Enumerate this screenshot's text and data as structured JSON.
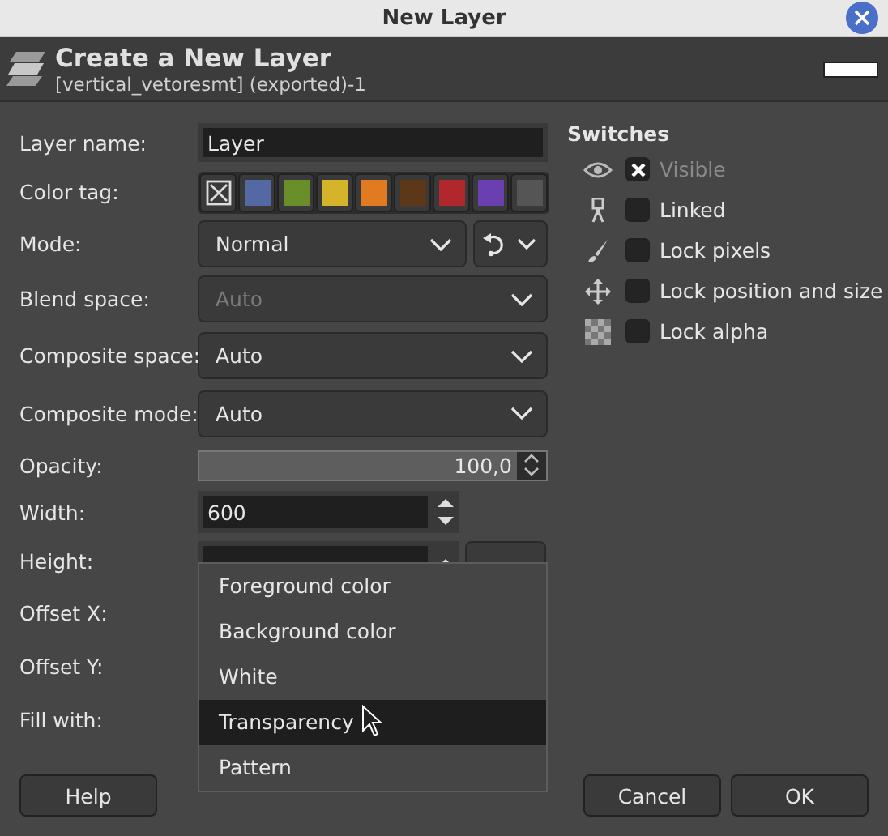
{
  "window": {
    "title": "New Layer"
  },
  "header": {
    "title": "Create a New Layer",
    "subtitle": "[vertical_vetoresmt] (exported)-1"
  },
  "form": [
    {
      "label": "Layer name:",
      "kind": "text",
      "value": "Layer"
    },
    {
      "label": "Color tag:",
      "kind": "colortag",
      "tags": [
        {
          "kind": "none"
        },
        {
          "kind": "color",
          "color": "#5468a4"
        },
        {
          "kind": "color",
          "color": "#6a8f2a"
        },
        {
          "kind": "color",
          "color": "#d4b52a"
        },
        {
          "kind": "color",
          "color": "#e07b22"
        },
        {
          "kind": "color",
          "color": "#5c3718"
        },
        {
          "kind": "color",
          "color": "#b0272c"
        },
        {
          "kind": "color",
          "color": "#6a3fb0"
        },
        {
          "kind": "color",
          "color": "#555555"
        }
      ]
    },
    {
      "label": "Mode:",
      "kind": "mode",
      "value": "Normal",
      "disabled": false
    },
    {
      "label": "Blend space:",
      "kind": "combo",
      "value": "Auto",
      "disabled": true
    },
    {
      "label": "Composite space:",
      "kind": "combo",
      "value": "Auto",
      "disabled": false
    },
    {
      "label": "Composite mode:",
      "kind": "combo",
      "value": "Auto",
      "disabled": false
    },
    {
      "label": "Opacity:",
      "kind": "scale",
      "value": "100,0",
      "level": 1
    },
    {
      "label": "Width:",
      "kind": "spin",
      "value": "600"
    },
    {
      "label": "Height:",
      "kind": "spin_unit"
    },
    {
      "label": "Offset X:",
      "kind": "label"
    },
    {
      "label": "Offset Y:",
      "kind": "label"
    },
    {
      "label": "Fill with:",
      "kind": "label"
    }
  ],
  "switches": {
    "title": "Switches",
    "items": [
      {
        "kind": "eye",
        "label": "Visible",
        "checked": true,
        "disabled": true
      },
      {
        "kind": "chain",
        "label": "Linked",
        "checked": false,
        "disabled": false
      },
      {
        "kind": "brush",
        "label": "Lock pixels",
        "checked": false,
        "disabled": false
      },
      {
        "kind": "move",
        "label": "Lock position and size",
        "checked": false,
        "disabled": false
      },
      {
        "kind": "checker",
        "label": "Lock alpha",
        "checked": false,
        "disabled": false
      }
    ]
  },
  "fill_menu": [
    {
      "label": "Foreground color",
      "selected": false
    },
    {
      "label": "Background color",
      "selected": false
    },
    {
      "label": "White",
      "selected": false
    },
    {
      "label": "Transparency",
      "selected": true
    },
    {
      "label": "Pattern",
      "selected": false
    }
  ],
  "buttons": {
    "left": [
      "Help"
    ],
    "right": [
      "Cancel",
      "OK"
    ]
  }
}
